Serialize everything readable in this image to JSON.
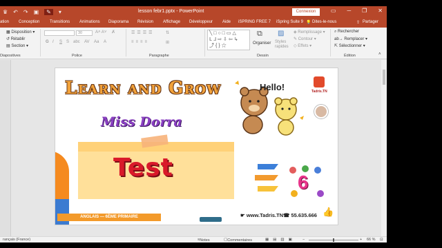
{
  "titlebar": {
    "title": "lesson febr1.pptx  -  PowerPoint",
    "connect_label": "Connexion",
    "minimize_glyph": "─",
    "restore_glyph": "❐",
    "close_glyph": "✕"
  },
  "tabs": {
    "file": "ation",
    "items": [
      "Conception",
      "Transitions",
      "Animations",
      "Diaporama",
      "Révision",
      "Affichage",
      "Développeur",
      "Aide",
      "iSPRING FREE 7",
      "iSpring Suite 9"
    ],
    "tell_me": "Dites-le-nous",
    "share": "Partager"
  },
  "ribbon": {
    "layout": "Disposition",
    "reset": "Rétablir",
    "section": "Section",
    "slides_group": "Diapositives",
    "font_group": "Police",
    "paragraph_group": "Paragraphe",
    "drawing_group": "Dessin",
    "editing_group": "Édition",
    "font_size": "30",
    "fill": "Remplissage",
    "outline": "Contour",
    "effects": "Effets",
    "arrange": "Organiser",
    "quick_styles": "Styles rapides",
    "find": "Rechercher",
    "replace": "Remplacer",
    "select": "Sélectionner"
  },
  "slide": {
    "headline": "Learn and Grow",
    "teacher": "Miss Dorra",
    "test_word": "Test",
    "hello": "Hello!",
    "brand": "Tadris.TN",
    "footer_label": "ANGLAIS — 6ÈME PRIMAIRE",
    "website": "www.Tadris.TN",
    "phone": "55.635.666",
    "grade": "6",
    "colors": {
      "headline": "#f2a23a",
      "teacher": "#8a3fc2",
      "test": "#d9192a",
      "note": "#ffe09a",
      "footer": "#f39a2a"
    }
  },
  "status": {
    "language": "rançais (France)",
    "notes": "Notes",
    "comments": "Commentaires",
    "zoom": "66 %"
  }
}
